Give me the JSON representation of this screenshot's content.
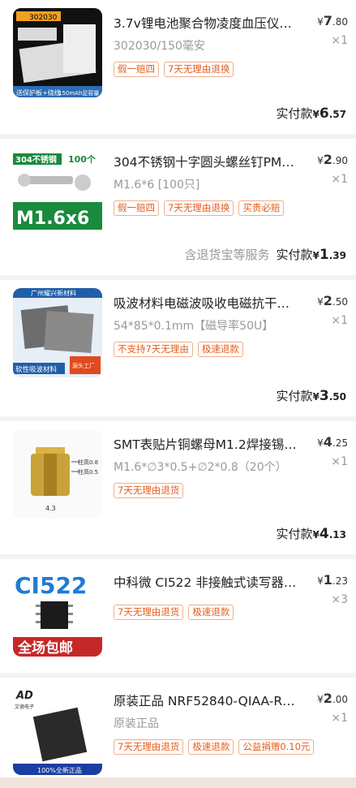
{
  "items": [
    {
      "title": "3.7v锂电池聚合物凌度血压仪…",
      "spec": "302030/150毫安",
      "price_yen": "¥",
      "price_int": "7",
      "price_dec": ".80",
      "qty": "×1",
      "tags": [
        "假一赔四",
        "7天无理由退换"
      ],
      "service": "",
      "paid_label": "实付款",
      "paid_yen": "¥",
      "paid_int": "6",
      "paid_dec": ".57",
      "thumb": {
        "line1": "302030",
        "line2": "150mAh足容量",
        "line3": "送保护板+绕线",
        "accent": "#2c6db5"
      }
    },
    {
      "title": "304不锈钢十字圆头螺丝钉PM…",
      "spec": "M1.6*6 [100只]",
      "price_yen": "¥",
      "price_int": "2",
      "price_dec": ".90",
      "qty": "×1",
      "tags": [
        "假一赔四",
        "7天无理由退换",
        "买贵必赔"
      ],
      "service": "含退货宝等服务",
      "paid_label": "实付款",
      "paid_yen": "¥",
      "paid_int": "1",
      "paid_dec": ".39",
      "thumb": {
        "line1": "304不锈钢",
        "line2": "100个",
        "line3": "M1.6x6",
        "accent": "#1a8a3c"
      }
    },
    {
      "title": "吸波材料电磁波吸收电磁抗干…",
      "spec": "54*85*0.1mm【磁导率50U】",
      "price_yen": "¥",
      "price_int": "2",
      "price_dec": ".50",
      "qty": "×1",
      "tags": [
        "不支持7天无理由",
        "极速退款"
      ],
      "service": "",
      "paid_label": "实付款",
      "paid_yen": "¥",
      "paid_int": "3",
      "paid_dec": ".50",
      "thumb": {
        "line1": "广州耀兴新材料",
        "line2": "软性吸波材料",
        "line3": "源头工厂",
        "accent": "#1f5fa8"
      }
    },
    {
      "title": "SMT表贴片铜螺母M1.2焊接锡…",
      "spec": "M1.6*∅3*0.5+∅2*0.8（20个）",
      "price_yen": "¥",
      "price_int": "4",
      "price_dec": ".25",
      "qty": "×1",
      "tags": [
        "7天无理由退货"
      ],
      "service": "",
      "paid_label": "实付款",
      "paid_yen": "¥",
      "paid_int": "4",
      "paid_dec": ".13",
      "thumb": {
        "line1": "4.3",
        "line2": "柱高0.8",
        "line3": "柱高0.5",
        "accent": "#c9a23a"
      }
    },
    {
      "title": "中科微 CI522 非接触式读写器…",
      "spec": "",
      "price_yen": "¥",
      "price_int": "1",
      "price_dec": ".23",
      "qty": "×3",
      "tags": [
        "7天无理由退货",
        "极速退款"
      ],
      "service": "",
      "paid_label": "",
      "paid_yen": "",
      "paid_int": "",
      "paid_dec": "",
      "thumb": {
        "line1": "CI522",
        "line2": "全场包邮",
        "line3": "",
        "accent": "#1e7bd6"
      }
    },
    {
      "title": "原装正品 NRF52840-QIAA-R…",
      "spec": "原装正品",
      "price_yen": "¥",
      "price_int": "2",
      "price_dec": ".00",
      "qty": "×1",
      "tags": [
        "7天无理由退货",
        "极速退款",
        "公益捐赠0.10元"
      ],
      "service": "",
      "paid_label": "",
      "paid_yen": "",
      "paid_int": "",
      "paid_dec": "",
      "thumb": {
        "line1": "AD",
        "line2": "100%全新正品",
        "line3": "文德电子",
        "accent": "#1a3fa0"
      }
    }
  ]
}
